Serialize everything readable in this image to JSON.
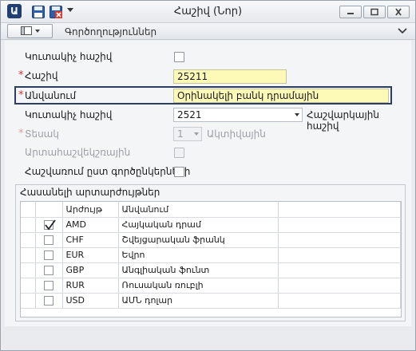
{
  "window": {
    "title": "Հաշիվ (Նոր)"
  },
  "toolbar": {
    "actions_label": "Գործողություններ"
  },
  "form": {
    "row1": {
      "label": "Կուտակիչ հաշիվ",
      "checked": false
    },
    "account": {
      "label": "Հաշիվ",
      "value": "25211",
      "required": true
    },
    "name": {
      "label": "Անվանում",
      "value": "Օրինակելի բանկ դրամային",
      "required": true
    },
    "accumulating": {
      "label": "Կուտակիչ հաշիվ",
      "value": "2521",
      "after": "Հաշվարկային հաշիվ"
    },
    "type": {
      "label": "Տեսակ",
      "value": "1",
      "after": "Ակտիվային",
      "required": true,
      "disabled": true
    },
    "offbalance": {
      "label": "Արտահաշվեկշռային",
      "checked": false,
      "disabled": true
    },
    "by_partners": {
      "label": "Հաշվառում ըստ գործընկերների",
      "checked": false
    }
  },
  "group": {
    "title": "Հասանելի արտարժույթներ",
    "columns": [
      "",
      "Արժույթ",
      "Անվանում",
      ""
    ],
    "rows": [
      {
        "code": "AMD",
        "name": "Հայկական դրամ",
        "checked": true
      },
      {
        "code": "CHF",
        "name": "Շվեյցարական ֆրանկ",
        "checked": false
      },
      {
        "code": "EUR",
        "name": "Եվրո",
        "checked": false
      },
      {
        "code": "GBP",
        "name": "Անգլիական ֆունտ",
        "checked": false
      },
      {
        "code": "RUR",
        "name": "Ռուսական ռուբլի",
        "checked": false
      },
      {
        "code": "USD",
        "name": "ԱՄՆ դոլար",
        "checked": false
      }
    ]
  },
  "icons": {
    "app": "app-logo-icon",
    "save": "save-icon",
    "save_close": "save-close-icon",
    "menu": "dropdown-arrow-icon",
    "minimize": "minimize-icon",
    "maximize": "maximize-icon",
    "close": "close-icon",
    "layout": "layout-panel-icon",
    "collapse": "chevron-collapse-icon"
  },
  "colors": {
    "required": "#dd3333",
    "highlight_field": "#fdf9b6",
    "focus_border": "#2c3e63"
  }
}
